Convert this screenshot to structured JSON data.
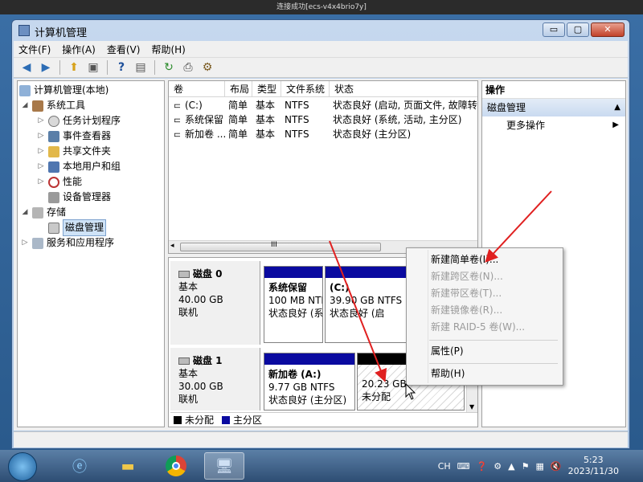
{
  "rdp": {
    "title": "连接成功[ecs-v4x4brio7y]"
  },
  "window": {
    "title": "计算机管理",
    "controls": {
      "minimize": "▭",
      "maximize": "▢",
      "close": "✕"
    }
  },
  "menu": [
    "文件(F)",
    "操作(A)",
    "查看(V)",
    "帮助(H)"
  ],
  "toolbar": {
    "icons": [
      "back-icon",
      "forward-icon",
      "up-icon",
      "show-hide-tree-icon",
      "help-icon",
      "show-hide-action-icon",
      "refresh-icon",
      "export-icon",
      "properties-icon"
    ]
  },
  "tree": {
    "root": "计算机管理(本地)",
    "system_tools": "系统工具",
    "task_scheduler": "任务计划程序",
    "event_viewer": "事件查看器",
    "shared_folders": "共享文件夹",
    "local_users": "本地用户和组",
    "performance": "性能",
    "device_manager": "设备管理器",
    "storage": "存储",
    "disk_management": "磁盘管理",
    "services": "服务和应用程序"
  },
  "volume_list": {
    "columns": [
      "卷",
      "布局",
      "类型",
      "文件系统",
      "状态"
    ],
    "rows": [
      [
        "(C:)",
        "简单",
        "基本",
        "NTFS",
        "状态良好 (启动, 页面文件, 故障转储"
      ],
      [
        "系统保留",
        "简单",
        "基本",
        "NTFS",
        "状态良好 (系统, 活动, 主分区)"
      ],
      [
        "新加卷 ...",
        "简单",
        "基本",
        "NTFS",
        "状态良好 (主分区)"
      ]
    ],
    "scroll_glyph": "III"
  },
  "disks": [
    {
      "name": "磁盘 0",
      "type": "基本",
      "size": "40.00 GB",
      "status": "联机",
      "partitions": [
        {
          "name": "系统保留",
          "size": "100 MB NTF",
          "status": "状态良好 (系"
        },
        {
          "name": "(C:)",
          "size": "39.90 GB NTFS",
          "status": "状态良好 (启"
        }
      ]
    },
    {
      "name": "磁盘 1",
      "type": "基本",
      "size": "30.00 GB",
      "status": "联机",
      "partitions": [
        {
          "name": "新加卷  (A:)",
          "size": "9.77 GB NTFS",
          "status": "状态良好 (主分区)"
        },
        {
          "name": "",
          "size": "20.23 GB",
          "status": "未分配"
        }
      ]
    }
  ],
  "legend": {
    "unallocated": "未分配",
    "primary": "主分区"
  },
  "actions": {
    "header": "操作",
    "section": "磁盘管理",
    "more": "更多操作"
  },
  "context_menu": {
    "items": [
      {
        "label": "新建简单卷(I)...",
        "enabled": true
      },
      {
        "label": "新建跨区卷(N)...",
        "enabled": false
      },
      {
        "label": "新建带区卷(T)...",
        "enabled": false
      },
      {
        "label": "新建镜像卷(R)...",
        "enabled": false
      },
      {
        "label": "新建 RAID-5 卷(W)...",
        "enabled": false
      },
      {
        "label": "属性(P)",
        "enabled": true
      },
      {
        "label": "帮助(H)",
        "enabled": true
      }
    ]
  },
  "taskbar": {
    "language": "CH",
    "time": "5:23",
    "date": "2023/11/30",
    "apps": [
      "start-orb-icon",
      "internet-explorer-icon",
      "file-explorer-icon",
      "chrome-icon",
      "computer-management-icon"
    ]
  },
  "colors": {
    "primary_partition_band": "#0a0aa0",
    "unallocated_band": "#000000",
    "annotation_arrow": "#e02020"
  }
}
